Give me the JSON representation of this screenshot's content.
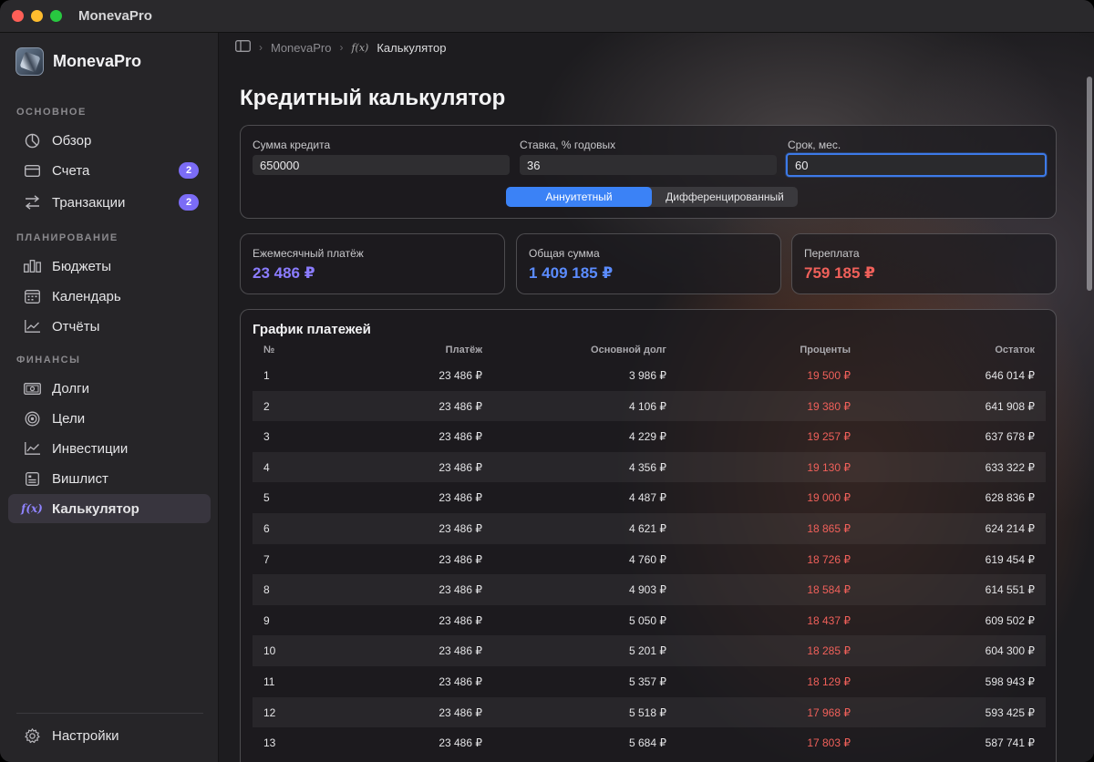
{
  "window": {
    "title": "MonevaPro"
  },
  "sidebar": {
    "brand": "MonevaPro",
    "sections": [
      {
        "label": "ОСНОВНОЕ"
      },
      {
        "label": "ПЛАНИРОВАНИЕ"
      },
      {
        "label": "ФИНАНСЫ"
      }
    ],
    "items": [
      {
        "label": "Обзор",
        "icon": "pie-chart-icon"
      },
      {
        "label": "Счета",
        "icon": "card-icon",
        "badge": "2"
      },
      {
        "label": "Транзакции",
        "icon": "arrows-icon",
        "badge": "2"
      },
      {
        "label": "Бюджеты",
        "icon": "bars-icon"
      },
      {
        "label": "Календарь",
        "icon": "calendar-icon"
      },
      {
        "label": "Отчёты",
        "icon": "line-chart-icon"
      },
      {
        "label": "Долги",
        "icon": "banknote-icon"
      },
      {
        "label": "Цели",
        "icon": "target-icon"
      },
      {
        "label": "Инвестиции",
        "icon": "trend-icon"
      },
      {
        "label": "Вишлист",
        "icon": "list-icon"
      },
      {
        "label": "Калькулятор",
        "icon": "fx-icon",
        "active": true
      }
    ],
    "settings": "Настройки"
  },
  "breadcrumb": {
    "root": "MonevaPro",
    "current": "Калькулятор"
  },
  "page": {
    "title": "Кредитный калькулятор"
  },
  "form": {
    "amount_label": "Сумма кредита",
    "amount_value": "650000",
    "rate_label": "Ставка, % годовых",
    "rate_value": "36",
    "term_label": "Срок, мес.",
    "term_value": "60",
    "mode_annuity": "Аннуитетный",
    "mode_diff": "Дифференцированный",
    "selected_mode": "Аннуитетный"
  },
  "stats": {
    "monthly_label": "Ежемесячный платёж",
    "monthly_value": "23 486 ₽",
    "total_label": "Общая сумма",
    "total_value": "1 409 185 ₽",
    "overpay_label": "Переплата",
    "overpay_value": "759 185 ₽"
  },
  "colors": {
    "monthly": "#8b7cff",
    "total": "#5b8cff",
    "overpay": "#f0605a",
    "accent": "#3b82f6"
  },
  "schedule": {
    "title": "График платежей",
    "columns": [
      "№",
      "Платёж",
      "Основной долг",
      "Проценты",
      "Остаток"
    ],
    "rows": [
      [
        "1",
        "23 486 ₽",
        "3 986 ₽",
        "19 500 ₽",
        "646 014 ₽"
      ],
      [
        "2",
        "23 486 ₽",
        "4 106 ₽",
        "19 380 ₽",
        "641 908 ₽"
      ],
      [
        "3",
        "23 486 ₽",
        "4 229 ₽",
        "19 257 ₽",
        "637 678 ₽"
      ],
      [
        "4",
        "23 486 ₽",
        "4 356 ₽",
        "19 130 ₽",
        "633 322 ₽"
      ],
      [
        "5",
        "23 486 ₽",
        "4 487 ₽",
        "19 000 ₽",
        "628 836 ₽"
      ],
      [
        "6",
        "23 486 ₽",
        "4 621 ₽",
        "18 865 ₽",
        "624 214 ₽"
      ],
      [
        "7",
        "23 486 ₽",
        "4 760 ₽",
        "18 726 ₽",
        "619 454 ₽"
      ],
      [
        "8",
        "23 486 ₽",
        "4 903 ₽",
        "18 584 ₽",
        "614 551 ₽"
      ],
      [
        "9",
        "23 486 ₽",
        "5 050 ₽",
        "18 437 ₽",
        "609 502 ₽"
      ],
      [
        "10",
        "23 486 ₽",
        "5 201 ₽",
        "18 285 ₽",
        "604 300 ₽"
      ],
      [
        "11",
        "23 486 ₽",
        "5 357 ₽",
        "18 129 ₽",
        "598 943 ₽"
      ],
      [
        "12",
        "23 486 ₽",
        "5 518 ₽",
        "17 968 ₽",
        "593 425 ₽"
      ],
      [
        "13",
        "23 486 ₽",
        "5 684 ₽",
        "17 803 ₽",
        "587 741 ₽"
      ]
    ]
  }
}
